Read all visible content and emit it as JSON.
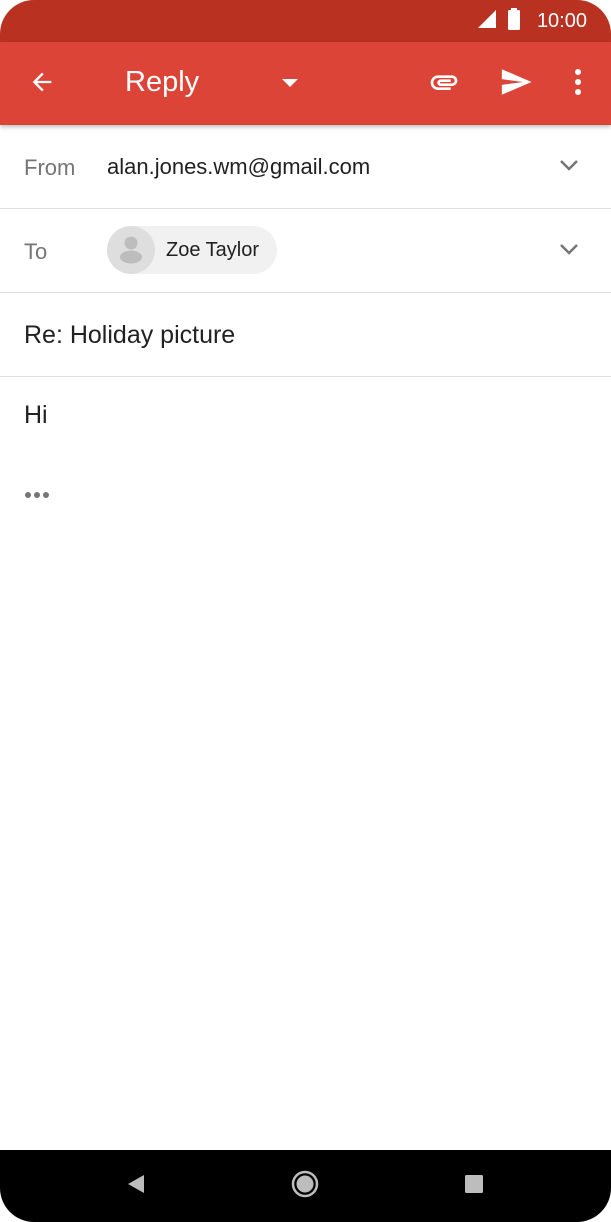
{
  "status_bar": {
    "time": "10:00",
    "icons": [
      "signal-icon",
      "battery-icon"
    ]
  },
  "app_bar": {
    "title": "Reply",
    "icons": [
      "back-arrow-icon",
      "dropdown-arrow-icon",
      "attach-icon",
      "send-icon",
      "more-vert-icon"
    ]
  },
  "compose": {
    "from_label": "From",
    "from_value": "alan.jones.wm@gmail.com",
    "to_label": "To",
    "recipients": [
      {
        "name": "Zoe Taylor"
      }
    ],
    "subject": "Re: Holiday picture",
    "body": "Hi",
    "quoted_text_indicator": "•••"
  },
  "nav_bar": {
    "icons": [
      "nav-back-icon",
      "nav-home-icon",
      "nav-recent-icon"
    ]
  },
  "colors": {
    "status_bar": "#b93221",
    "app_bar": "#db4437",
    "text_primary": "#212121",
    "text_secondary": "#757575",
    "divider": "#e0e0e0",
    "chip_bg": "#f1f1f1"
  }
}
